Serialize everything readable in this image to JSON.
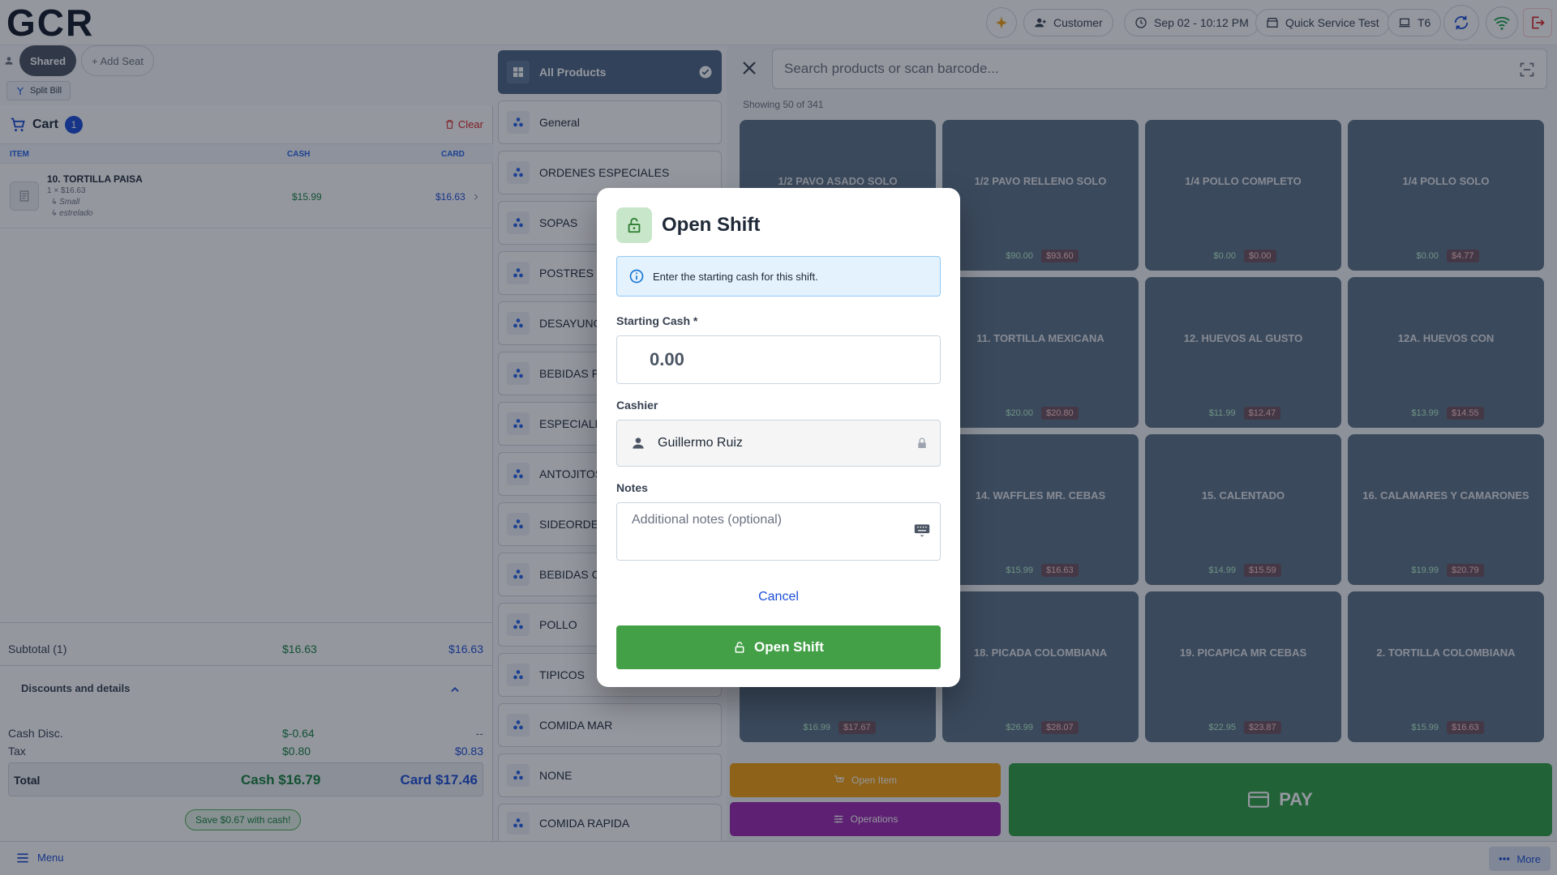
{
  "header": {
    "logo_text": "GCR",
    "customer_label": "Customer",
    "datetime": "Sep 02 - 10:12 PM",
    "store": "Quick Service Test",
    "terminal": "T6",
    "colors": {
      "logout": "#dc2626",
      "wifi": "#16a34a",
      "sync": "#1d4ed8"
    }
  },
  "seats": {
    "shared_label": "Shared",
    "add_seat_label": "+ Add Seat",
    "split_bill_label": "Split Bill"
  },
  "cart": {
    "title": "Cart",
    "count": "1",
    "clear_label": "Clear",
    "columns": {
      "item": "ITEM",
      "cash": "CASH",
      "card": "CARD"
    },
    "items": [
      {
        "name": "10. TORTILLA PAISA",
        "qty_price": "1 × $16.63",
        "modifiers": [
          "↳ Small",
          "↳ estrelado"
        ],
        "cash": "$15.99",
        "card": "$16.63"
      }
    ],
    "subtotal": {
      "label": "Subtotal (1)",
      "cash": "$16.63",
      "card": "$16.63"
    },
    "discounts_label": "Discounts and details",
    "cash_disc": {
      "label": "Cash Disc.",
      "cash": "$-0.64",
      "card": "--"
    },
    "tax": {
      "label": "Tax",
      "cash": "$0.80",
      "card": "$0.83"
    },
    "total": {
      "label": "Total",
      "cash": "Cash $16.79",
      "card": "Card $17.46"
    },
    "save_hint": "Save $0.67 with cash!"
  },
  "categories": [
    {
      "label": "All Products",
      "active": true
    },
    {
      "label": "General"
    },
    {
      "label": "ORDENES ESPECIALES"
    },
    {
      "label": "SOPAS"
    },
    {
      "label": "POSTRES"
    },
    {
      "label": "DESAYUNOS"
    },
    {
      "label": "BEBIDAS FRIAS"
    },
    {
      "label": "ESPECIALES"
    },
    {
      "label": "ANTOJITOS"
    },
    {
      "label": "SIDEORDERS"
    },
    {
      "label": "BEBIDAS CALIENTES"
    },
    {
      "label": "POLLO"
    },
    {
      "label": "TIPICOS"
    },
    {
      "label": "COMIDA MAR"
    },
    {
      "label": "NONE"
    },
    {
      "label": "COMIDA RAPIDA"
    }
  ],
  "products": {
    "search_placeholder": "Search products or scan barcode...",
    "showing": "Showing 50 of 341",
    "items": [
      {
        "name": "1/2 PAVO ASADO SOLO",
        "cash": "",
        "card": ""
      },
      {
        "name": "1/2 PAVO RELLENO SOLO",
        "cash": "$90.00",
        "card": "$93.60"
      },
      {
        "name": "1/4 POLLO COMPLETO",
        "cash": "$0.00",
        "card": "$0.00"
      },
      {
        "name": "1/4 POLLO SOLO",
        "cash": "$0.00",
        "card": "$4.77"
      },
      {
        "name": "",
        "cash": "",
        "card": ""
      },
      {
        "name": "11. TORTILLA MEXICANA",
        "cash": "$20.00",
        "card": "$20.80"
      },
      {
        "name": "12. HUEVOS AL GUSTO",
        "cash": "$11.99",
        "card": "$12.47"
      },
      {
        "name": "12A. HUEVOS CON",
        "cash": "$13.99",
        "card": "$14.55"
      },
      {
        "name": "",
        "cash": "",
        "card": ""
      },
      {
        "name": "14. WAFFLES  MR. CEBAS",
        "cash": "$15.99",
        "card": "$16.63"
      },
      {
        "name": "15. CALENTADO",
        "cash": "$14.99",
        "card": "$15.59"
      },
      {
        "name": "16. CALAMARES Y CAMARONES",
        "cash": "$19.99",
        "card": "$20.79"
      },
      {
        "name": "",
        "cash": "$16.99",
        "card": "$17.67"
      },
      {
        "name": "18. PICADA COLOMBIANA",
        "cash": "$26.99",
        "card": "$28.07"
      },
      {
        "name": "19. PICAPICA MR CEBAS",
        "cash": "$22.95",
        "card": "$23.87"
      },
      {
        "name": "2. TORTILLA COLOMBIANA",
        "cash": "$15.99",
        "card": "$16.63"
      }
    ],
    "open_item_label": "Open Item",
    "operations_label": "Operations",
    "pay_label": "PAY"
  },
  "footer": {
    "menu_label": "Menu",
    "more_label": "More"
  },
  "modal": {
    "title": "Open Shift",
    "info": "Enter the starting cash for this shift.",
    "starting_cash_label": "Starting Cash *",
    "starting_cash_placeholder": "0.00",
    "cashier_label": "Cashier",
    "cashier_value": "Guillermo Ruiz",
    "notes_label": "Notes",
    "notes_placeholder": "Additional notes (optional)",
    "cancel_label": "Cancel",
    "submit_label": "Open Shift"
  }
}
